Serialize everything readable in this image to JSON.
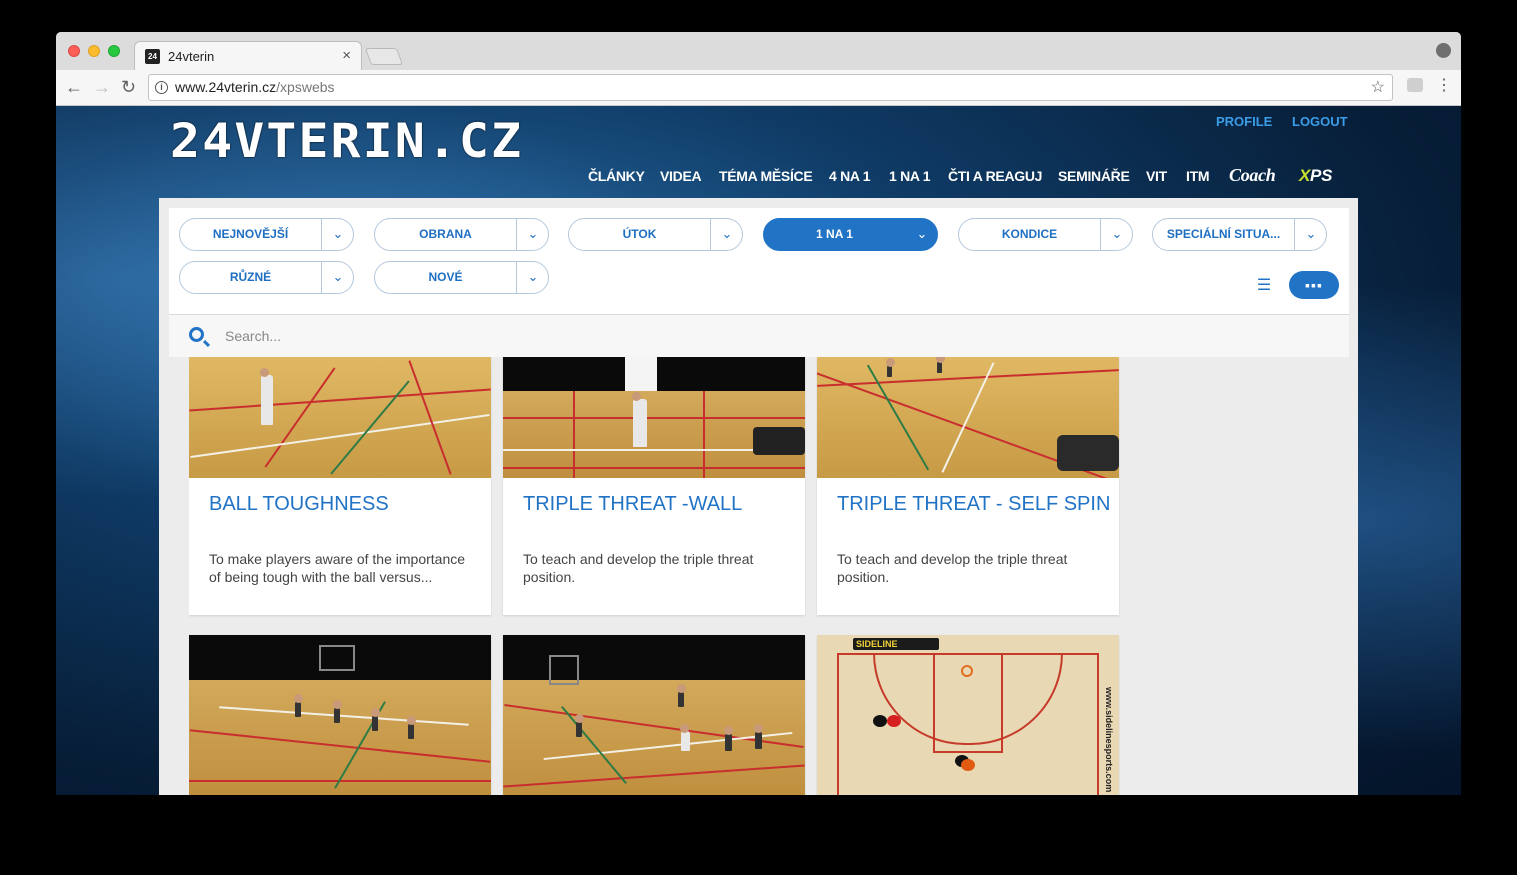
{
  "browser": {
    "tab_title": "24vterin",
    "tab_close": "×",
    "url_host": "www.24vterin.cz",
    "url_path": "/xpswebs",
    "favicon_text": "24"
  },
  "site": {
    "logo_text": "24VTERIN.CZ",
    "top_links": [
      "PROFILE",
      "LOGOUT"
    ],
    "main_nav": [
      "ČLÁNKY",
      "VIDEA",
      "TÉMA MĚSÍCE",
      "4 NA 1",
      "1 NA 1",
      "ČTI A REAGUJ",
      "SEMINÁŘE",
      "VIT",
      "ITM"
    ],
    "coach_label": "Coach",
    "xps_label_a": "X",
    "xps_label_b": "PS"
  },
  "filters": [
    {
      "label": "NEJNOVĚJŠÍ",
      "active": false
    },
    {
      "label": "OBRANA",
      "active": false
    },
    {
      "label": "ÚTOK",
      "active": false
    },
    {
      "label": "1 NA 1",
      "active": true
    },
    {
      "label": "KONDICE",
      "active": false
    },
    {
      "label": "SPECIÁLNÍ SITUA...",
      "active": false
    },
    {
      "label": "RŮZNÉ",
      "active": false
    },
    {
      "label": "NOVÉ",
      "active": false
    }
  ],
  "search": {
    "placeholder": "Search..."
  },
  "cards": [
    {
      "title": "BALL TOUGHNESS",
      "description": "To make players aware of the importance of being tough with the ball versus..."
    },
    {
      "title": "TRIPLE THREAT -WALL",
      "description": "To teach and develop the triple threat position."
    },
    {
      "title": "TRIPLE THREAT - SELF SPIN",
      "description": "To teach and develop the triple threat position."
    }
  ],
  "diagram_brand": "SIDELINE",
  "diagram_url": "www.sidelinesports.com",
  "colors": {
    "accent": "#2173c6",
    "xps_green": "#c6e12c"
  }
}
